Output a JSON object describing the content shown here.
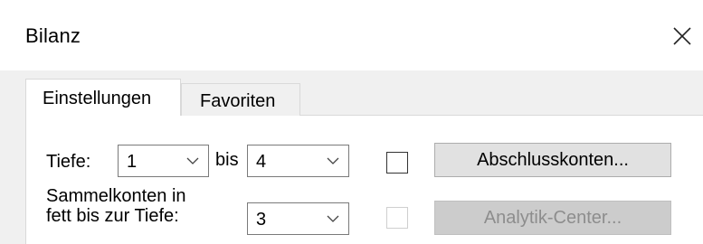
{
  "window": {
    "title": "Bilanz",
    "close_icon": "close-icon"
  },
  "tabs": [
    {
      "label": "Einstellungen",
      "active": true
    },
    {
      "label": "Favoriten",
      "active": false
    }
  ],
  "settings": {
    "tiefe_label": "Tiefe:",
    "tiefe_from": "1",
    "bis_label": "bis",
    "tiefe_to": "4",
    "abschluss_checked": false,
    "abschluss_button": "Abschlusskonten...",
    "sammel_label_line1": "Sammelkonten in",
    "sammel_label_line2": "fett bis zur Tiefe:",
    "sammel_value": "3",
    "analytik_checked": false,
    "analytik_button": "Analytik-Center..."
  },
  "colors": {
    "window_bg": "#ffffff",
    "client_bg": "#f0f0f0",
    "button_bg": "#e1e1e1",
    "disabled_button_bg": "#cccccc",
    "disabled_text": "#8d8d8d"
  }
}
